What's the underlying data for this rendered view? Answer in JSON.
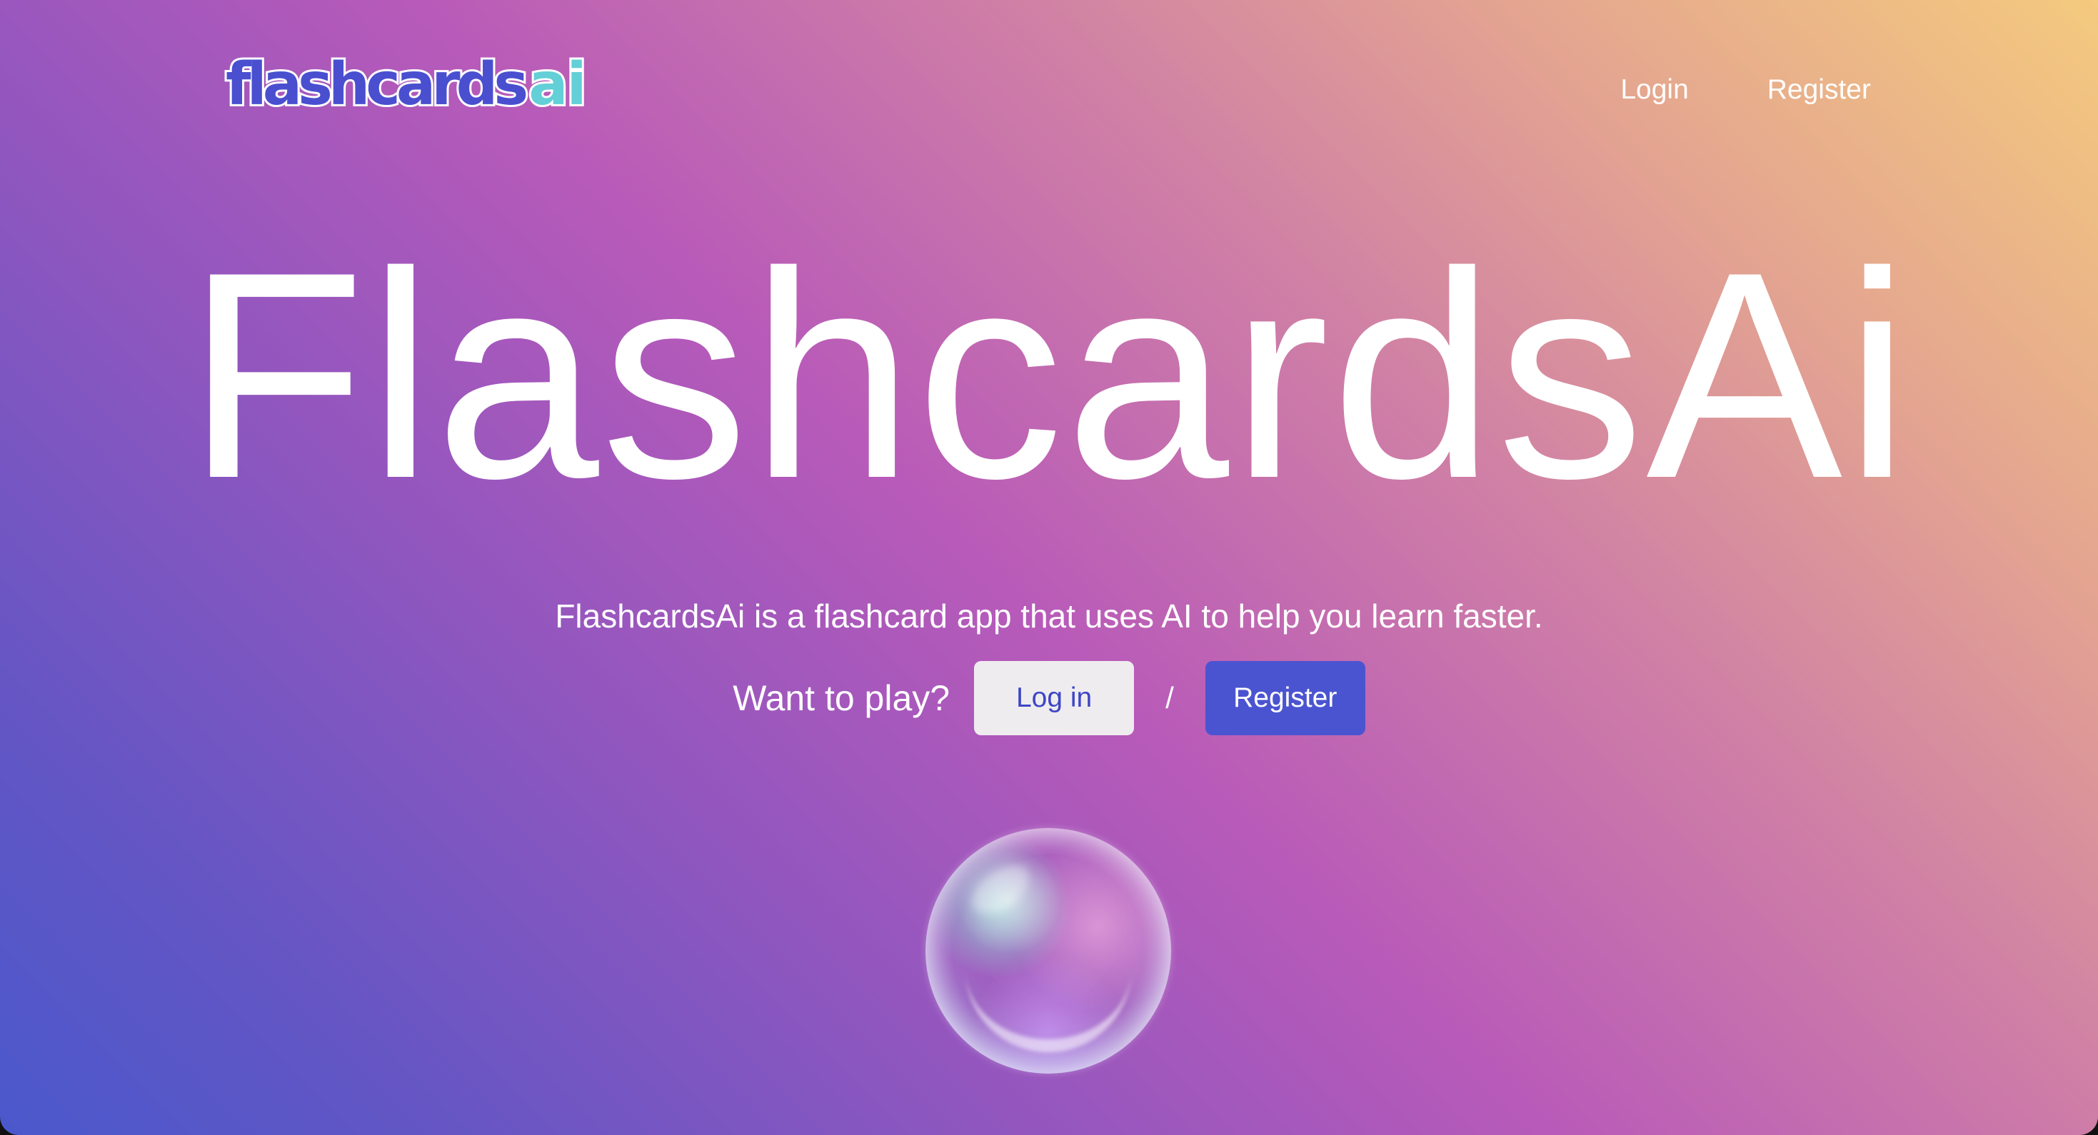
{
  "header": {
    "logo": {
      "part1": "flashcards",
      "part2": "ai"
    },
    "nav": {
      "login": "Login",
      "register": "Register"
    }
  },
  "hero": {
    "title": "FlashcardsAi",
    "tagline": "FlashcardsAi is a flashcard app that uses AI to help you learn faster.",
    "cta": {
      "prompt": "Want to play?",
      "login_button": "Log in",
      "separator": "/",
      "register_button": "Register"
    }
  },
  "colors": {
    "gradient_top_right": "#f4ca7e",
    "gradient_middle": "#b85ab9",
    "gradient_bottom_left": "#4a58cc",
    "logo_blue": "#4a4fd0",
    "logo_cyan": "#63cfd6",
    "login_button_bg": "#efecef",
    "login_button_text": "#3e46c4",
    "register_button_bg": "#4b54d0"
  },
  "decoration": {
    "bubble": "soap-bubble-illustration"
  }
}
